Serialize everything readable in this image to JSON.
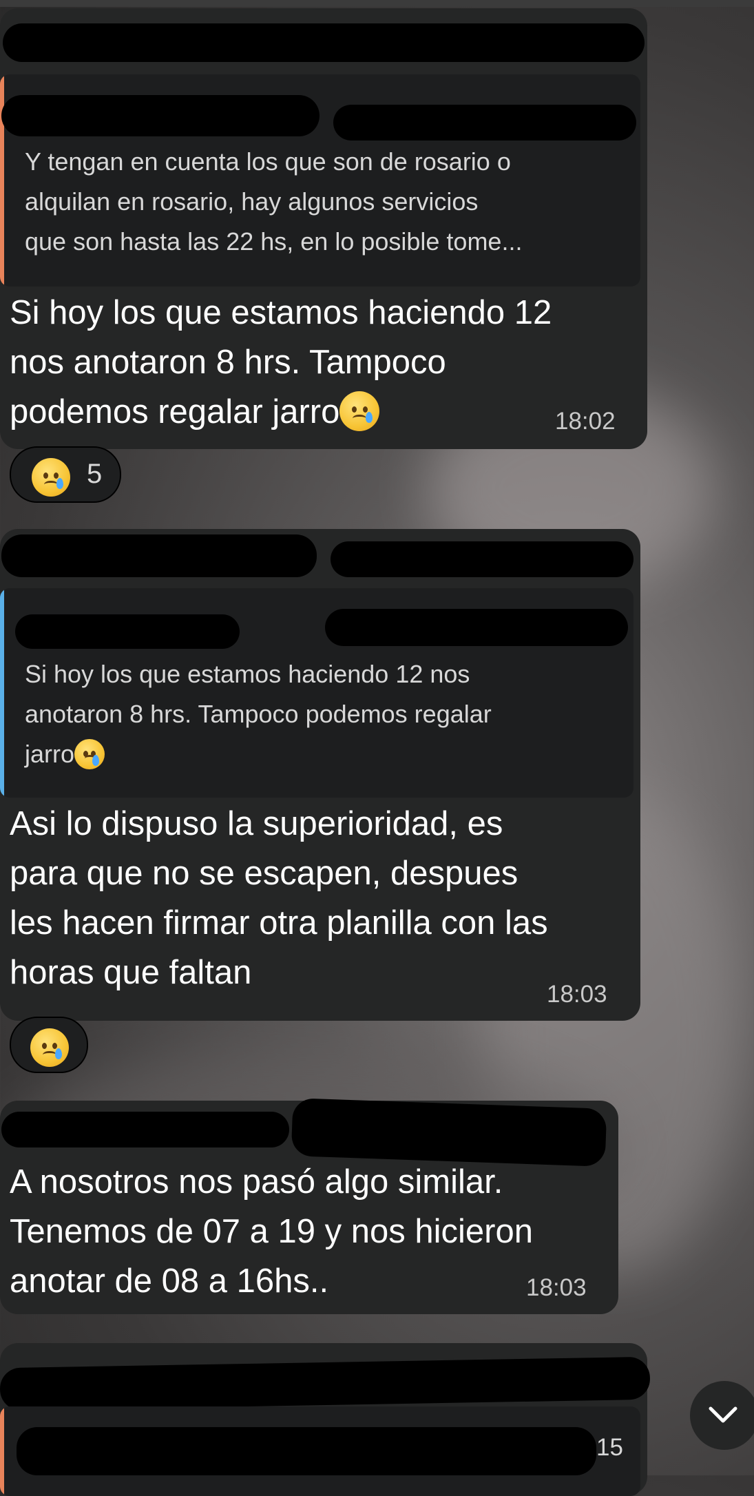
{
  "messages": [
    {
      "quote_text": "Y tengan en cuenta los que son de rosario o\nalquilan en rosario, hay algunos servicios\nque son hasta las 22 hs, en lo posible tome...",
      "text": "Si hoy los que estamos haciendo 12\nnos anotaron 8 hrs. Tampoco\npodemos regalar jarro",
      "time": "18:02",
      "reaction_count": "5"
    },
    {
      "quote_text": "Si hoy los que estamos haciendo 12 nos\nanotaron 8 hrs. Tampoco podemos regalar\njarro",
      "text": "Asi lo dispuso la superioridad, es\npara que no se escapen, despues\nles hacen firmar otra planilla con las\nhoras que faltan",
      "time": "18:03"
    },
    {
      "text": "A nosotros nos pasó algo similar.\nTenemos de 07 a 19 y nos hicieron\nanotar de 08 a 16hs..",
      "time": "18:03"
    },
    {
      "time_partial": "15"
    }
  ],
  "icons": {
    "reaction_1": "crying-face-icon",
    "reaction_2": "sad-relieved-face-icon",
    "scroll_down": "chevron-down-icon"
  },
  "colors": {
    "bubble": "#252626",
    "quote_bg": "#1d1e1f",
    "quote_bar_orange": "#e8835a",
    "quote_bar_blue": "#5ab0e8"
  }
}
